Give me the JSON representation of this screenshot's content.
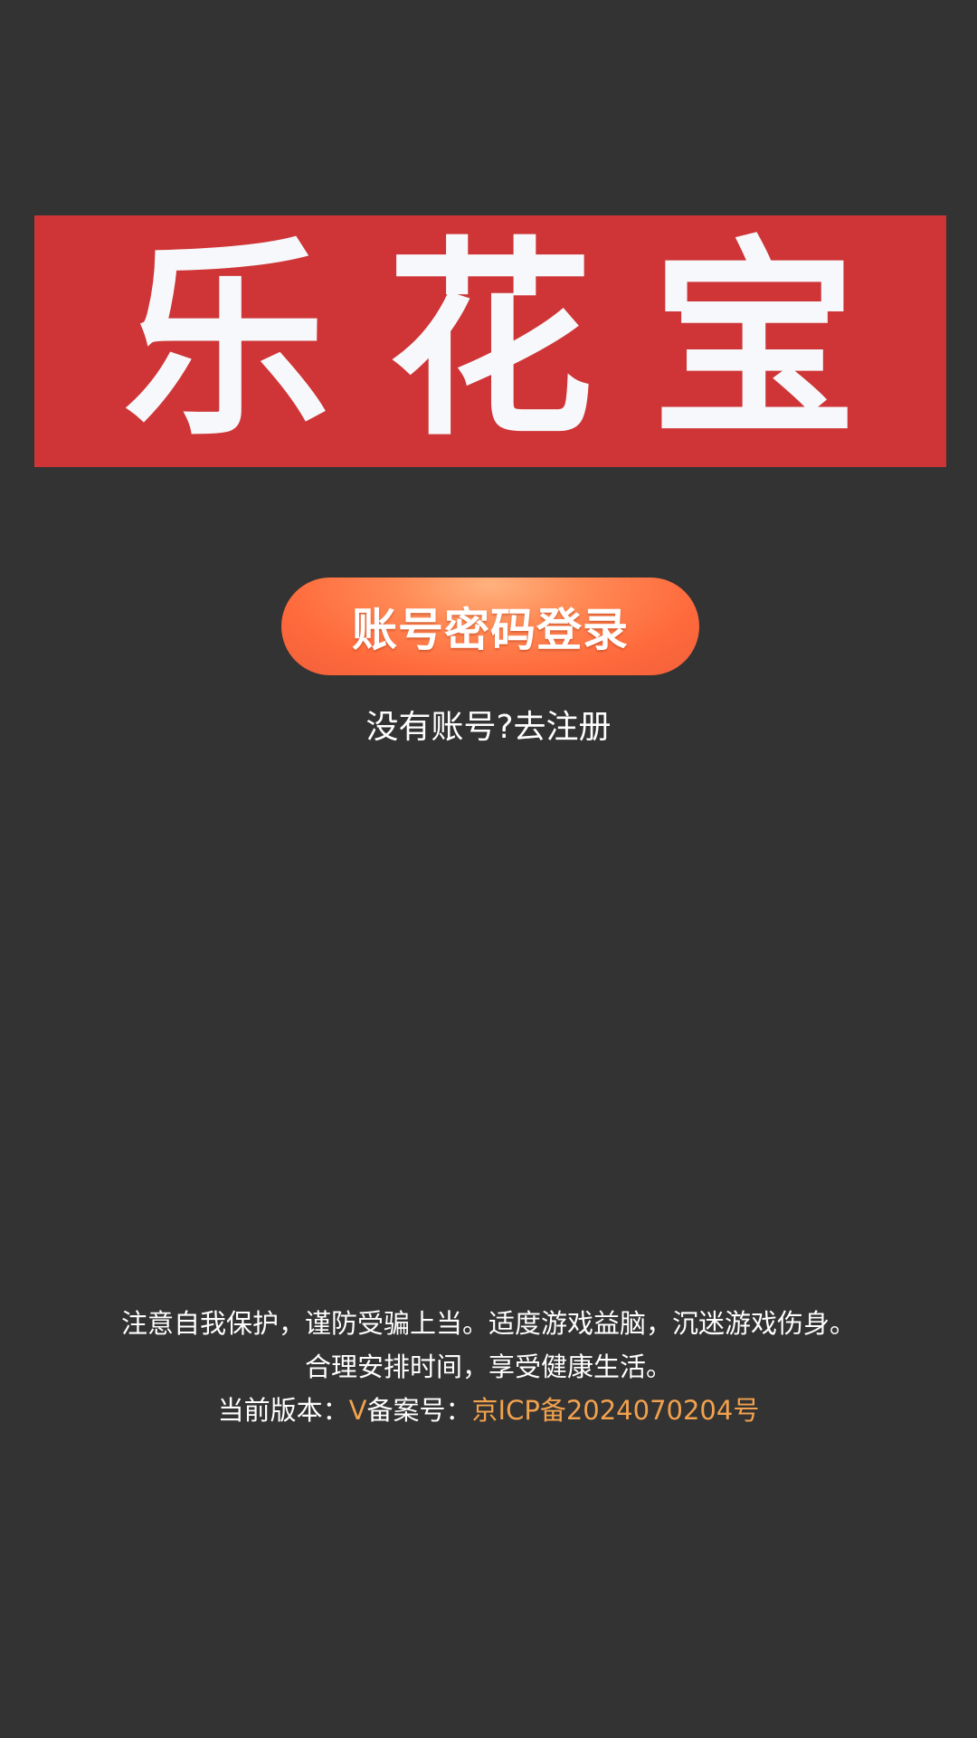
{
  "logo": {
    "text": "乐花宝",
    "background_color": "#cf3536",
    "text_color": "#f6f8fb"
  },
  "login": {
    "button_label": "账号密码登录",
    "button_color": "#ff6a3c"
  },
  "register": {
    "link_text": "没有账号?去注册"
  },
  "footer": {
    "notice_line1": "注意自我保护，谨防受骗上当。适度游戏益脑，沉迷游戏伤身。",
    "notice_line2": "合理安排时间，享受健康生活。",
    "version_label": "当前版本：",
    "version_value": "V",
    "icp_label": "备案号：",
    "icp_value": "京ICP备2024070204号",
    "accent_color": "#f2a24e"
  },
  "background_color": "#333333"
}
